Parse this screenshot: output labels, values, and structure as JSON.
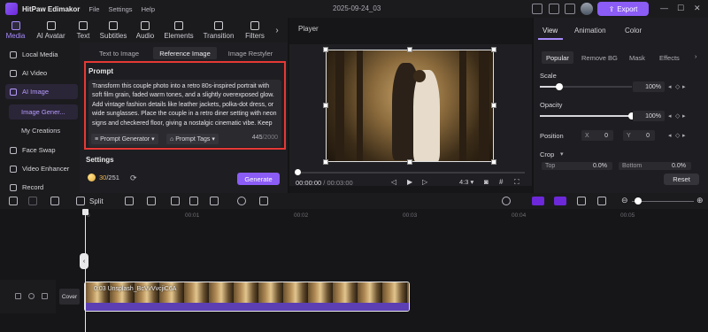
{
  "app": {
    "name": "HitPaw Edimakor",
    "menus": [
      "File",
      "Settings",
      "Help"
    ],
    "doc_title": "2025-09-24_03",
    "export_label": "Export"
  },
  "top_tabs": [
    {
      "label": "Media",
      "icon": "media-icon"
    },
    {
      "label": "AI Avatar",
      "icon": "ai-avatar-icon"
    },
    {
      "label": "Text",
      "icon": "text-icon"
    },
    {
      "label": "Subtitles",
      "icon": "subtitles-icon"
    },
    {
      "label": "Audio",
      "icon": "audio-icon"
    },
    {
      "label": "Elements",
      "icon": "elements-icon"
    },
    {
      "label": "Transition",
      "icon": "transition-icon"
    },
    {
      "label": "Filters",
      "icon": "filters-icon"
    }
  ],
  "sidebar": {
    "items": [
      {
        "label": "Local Media",
        "icon": "folder-icon"
      },
      {
        "label": "AI Video",
        "icon": "ai-video-icon"
      },
      {
        "label": "AI Image",
        "icon": "ai-image-icon"
      },
      {
        "label": "Image Gener...",
        "icon": ""
      },
      {
        "label": "My Creations",
        "icon": ""
      },
      {
        "label": "Face Swap",
        "icon": "face-swap-icon"
      },
      {
        "label": "Video Enhancer",
        "icon": "video-enhancer-icon"
      },
      {
        "label": "Record",
        "icon": "record-icon"
      }
    ]
  },
  "generator": {
    "tabs": [
      "Text to Image",
      "Reference Image",
      "Image Restyler"
    ],
    "prompt_label": "Prompt",
    "prompt_text": "Transform this couple photo into a retro 80s-inspired portrait with soft film grain, faded warm tones, and a slightly overexposed glow. Add vintage fashion details like leather jackets, polka-dot dress, or wide sunglasses. Place the couple in a retro diner setting with neon signs and checkered floor, giving a nostalgic cinematic vibe. Keep expressions natural and",
    "prompt_generator": "Prompt Generator",
    "prompt_tags": "Prompt Tags",
    "char_count": "445",
    "char_max": "/2000",
    "settings_label": "Settings",
    "credits": "30",
    "credits_total": "/251",
    "generate_label": "Generate"
  },
  "player": {
    "title": "Player",
    "time_current": "00:00:00",
    "time_total": "/ 00:03:00",
    "aspect": "4:3"
  },
  "right_panel": {
    "tabs": [
      "View",
      "Animation",
      "Color"
    ],
    "subtabs": [
      "Popular",
      "Remove BG",
      "Mask",
      "Effects"
    ],
    "scale_label": "Scale",
    "scale_value": "100%",
    "opacity_label": "Opacity",
    "opacity_value": "100%",
    "position_label": "Position",
    "pos_x_label": "X",
    "pos_x": "0",
    "pos_y_label": "Y",
    "pos_y": "0",
    "crop_label": "Crop",
    "crop_top_label": "Top",
    "crop_top": "0.0%",
    "crop_bottom_label": "Bottom",
    "crop_bottom": "0.0%",
    "reset_label": "Reset"
  },
  "timeline": {
    "split_label": "Split",
    "ruler": [
      "0",
      "00:01",
      "00:02",
      "00:03",
      "00:04",
      "00:05"
    ],
    "cover_label": "Cover",
    "clip_name": "0:03  Unsplash_BcVvVvcjiC6A"
  },
  "colors": {
    "accent": "#8b5cf6",
    "highlight_border": "#e53935",
    "clip_bar": "#5b3fb3"
  }
}
